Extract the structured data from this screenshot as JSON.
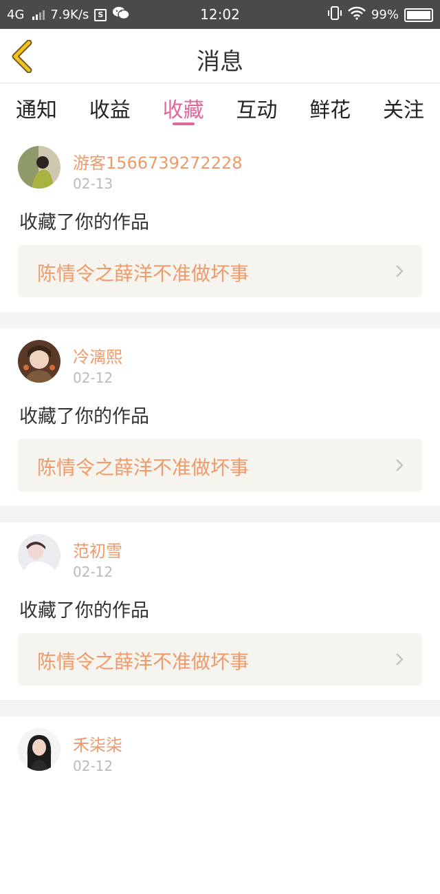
{
  "status_bar": {
    "network": "4G",
    "speed": "7.9K/s",
    "sim_icon_label": "S",
    "time": "12:02",
    "battery": "99%",
    "icons": [
      "signal-icon",
      "sim-icon",
      "wechat-icon",
      "vibrate-icon",
      "wifi-icon",
      "battery-icon"
    ]
  },
  "header": {
    "title": "消息",
    "back_icon": "chevron-left-icon",
    "back_color": "#f3c21b"
  },
  "tabs": [
    {
      "label": "通知",
      "active": false
    },
    {
      "label": "收益",
      "active": false
    },
    {
      "label": "收藏",
      "active": true
    },
    {
      "label": "互动",
      "active": false
    },
    {
      "label": "鲜花",
      "active": false
    },
    {
      "label": "关注",
      "active": false
    }
  ],
  "accent_colors": {
    "active_tab": "#e0679a",
    "username": "#ef9a6a",
    "link_bg": "#f5f4ef"
  },
  "messages": [
    {
      "username": "游客1566739272228",
      "date": "02-13",
      "action": "收藏了你的作品",
      "work": "陈情令之薛洋不准做坏事"
    },
    {
      "username": "冷漓熙",
      "date": "02-12",
      "action": "收藏了你的作品",
      "work": "陈情令之薛洋不准做坏事"
    },
    {
      "username": "范初雪",
      "date": "02-12",
      "action": "收藏了你的作品",
      "work": "陈情令之薛洋不准做坏事"
    },
    {
      "username": "禾柒柒",
      "date": "02-12",
      "action": "",
      "work": ""
    }
  ]
}
